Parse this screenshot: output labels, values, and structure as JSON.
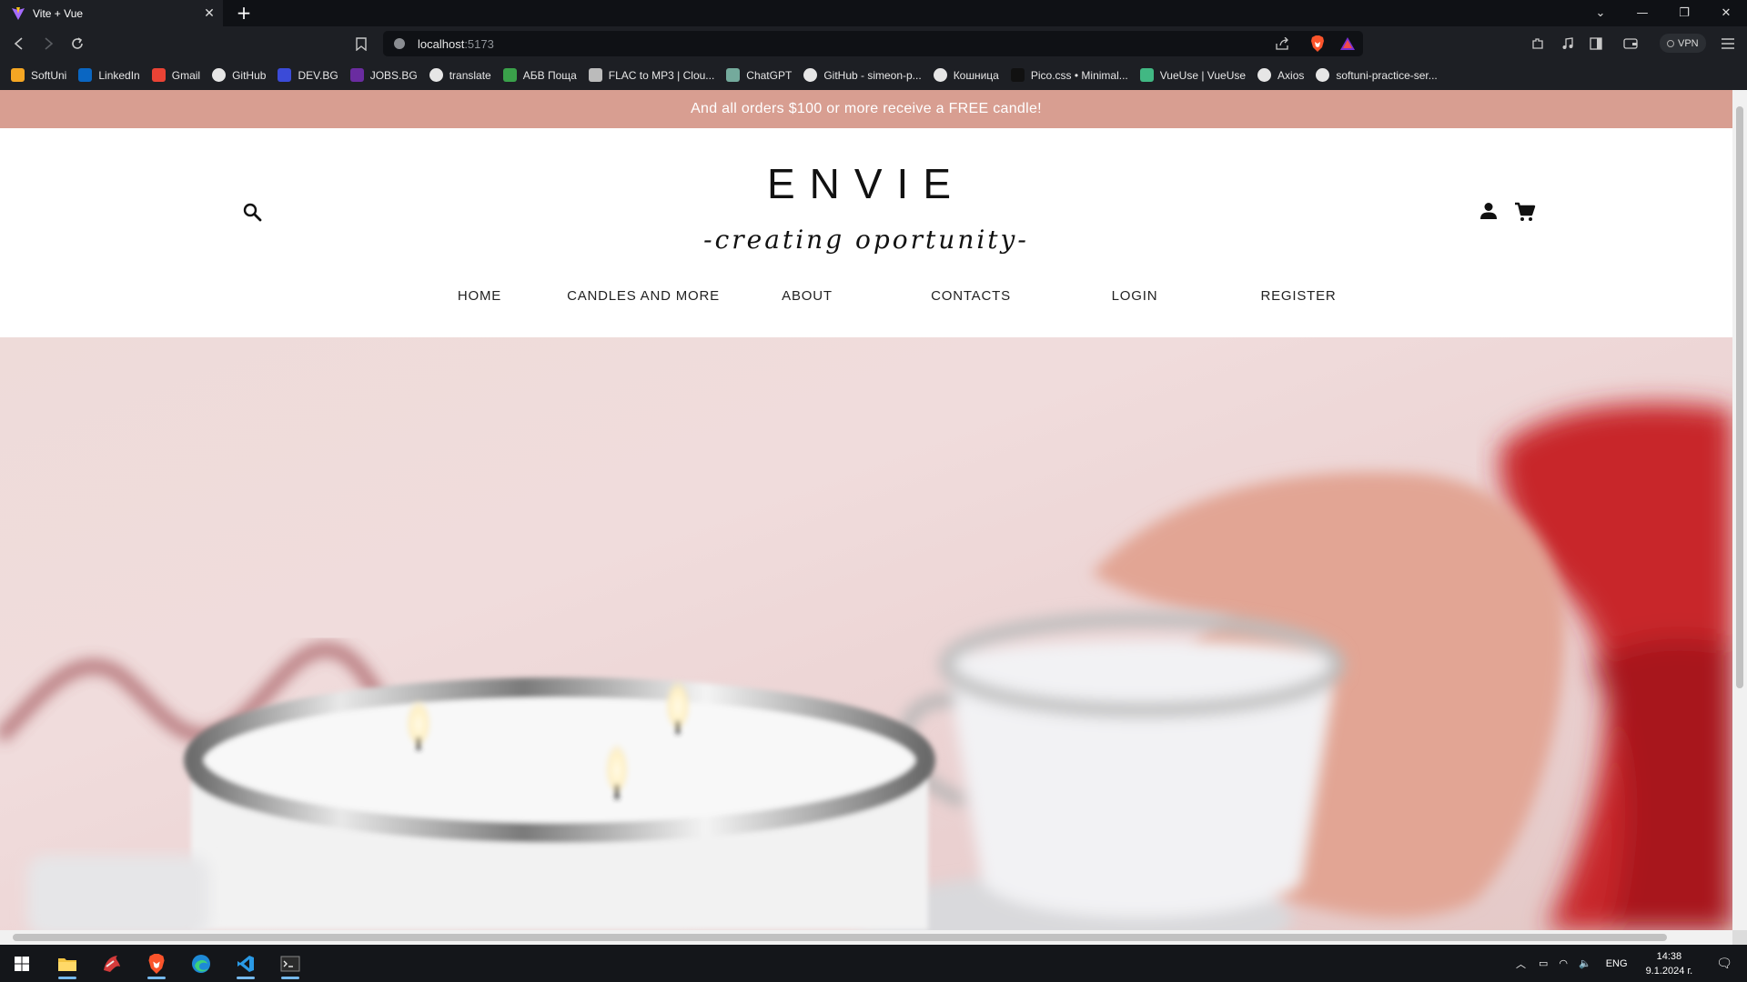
{
  "browser": {
    "tab": {
      "title": "Vite + Vue"
    },
    "address": {
      "host": "localhost",
      "port": ":5173"
    },
    "vpn_label": "VPN",
    "bookmarks": [
      {
        "label": "SoftUni",
        "icon": "softuni-icon",
        "color": "#f5a623"
      },
      {
        "label": "LinkedIn",
        "icon": "linkedin-icon",
        "color": "#0a66c2"
      },
      {
        "label": "Gmail",
        "icon": "gmail-icon",
        "color": "#ea4335"
      },
      {
        "label": "GitHub",
        "icon": "github-icon",
        "color": "#ffffff"
      },
      {
        "label": "DEV.BG",
        "icon": "devbg-icon",
        "color": "#3b4bd8"
      },
      {
        "label": "JOBS.BG",
        "icon": "jobsbg-icon",
        "color": "#6a2ca0"
      },
      {
        "label": "translate",
        "icon": "google-icon",
        "color": "#ffffff"
      },
      {
        "label": "АБВ Поща",
        "icon": "abv-icon",
        "color": "#3aa14a"
      },
      {
        "label": "FLAC to MP3 | Clou...",
        "icon": "cloudconvert-icon",
        "color": "#bbbbbb"
      },
      {
        "label": "ChatGPT",
        "icon": "chatgpt-icon",
        "color": "#74aa9c"
      },
      {
        "label": "GitHub - simeon-p...",
        "icon": "github-icon",
        "color": "#ffffff"
      },
      {
        "label": "Кошница",
        "icon": "cart-bookmark-icon",
        "color": "#ffffff"
      },
      {
        "label": "Pico.css • Minimal...",
        "icon": "pico-icon",
        "color": "#111111"
      },
      {
        "label": "VueUse | VueUse",
        "icon": "vueuse-icon",
        "color": "#41b883"
      },
      {
        "label": "Axios",
        "icon": "axios-icon",
        "color": "#ffffff"
      },
      {
        "label": "softuni-practice-ser...",
        "icon": "github-icon",
        "color": "#ffffff"
      }
    ]
  },
  "page": {
    "promo": "And all orders $100 or more receive a FREE candle!",
    "brand": "ENVIE",
    "tagline": "-creating oportunity-",
    "nav": [
      "HOME",
      "CANDLES AND MORE",
      "ABOUT",
      "CONTACTS",
      "LOGIN",
      "REGISTER"
    ]
  },
  "taskbar": {
    "language": "ENG",
    "time": "14:38",
    "date": "9.1.2024 г."
  },
  "colors": {
    "promo_bg": "#d89e91",
    "browser_chrome": "#1d1f24",
    "taskbar": "#14161a"
  }
}
